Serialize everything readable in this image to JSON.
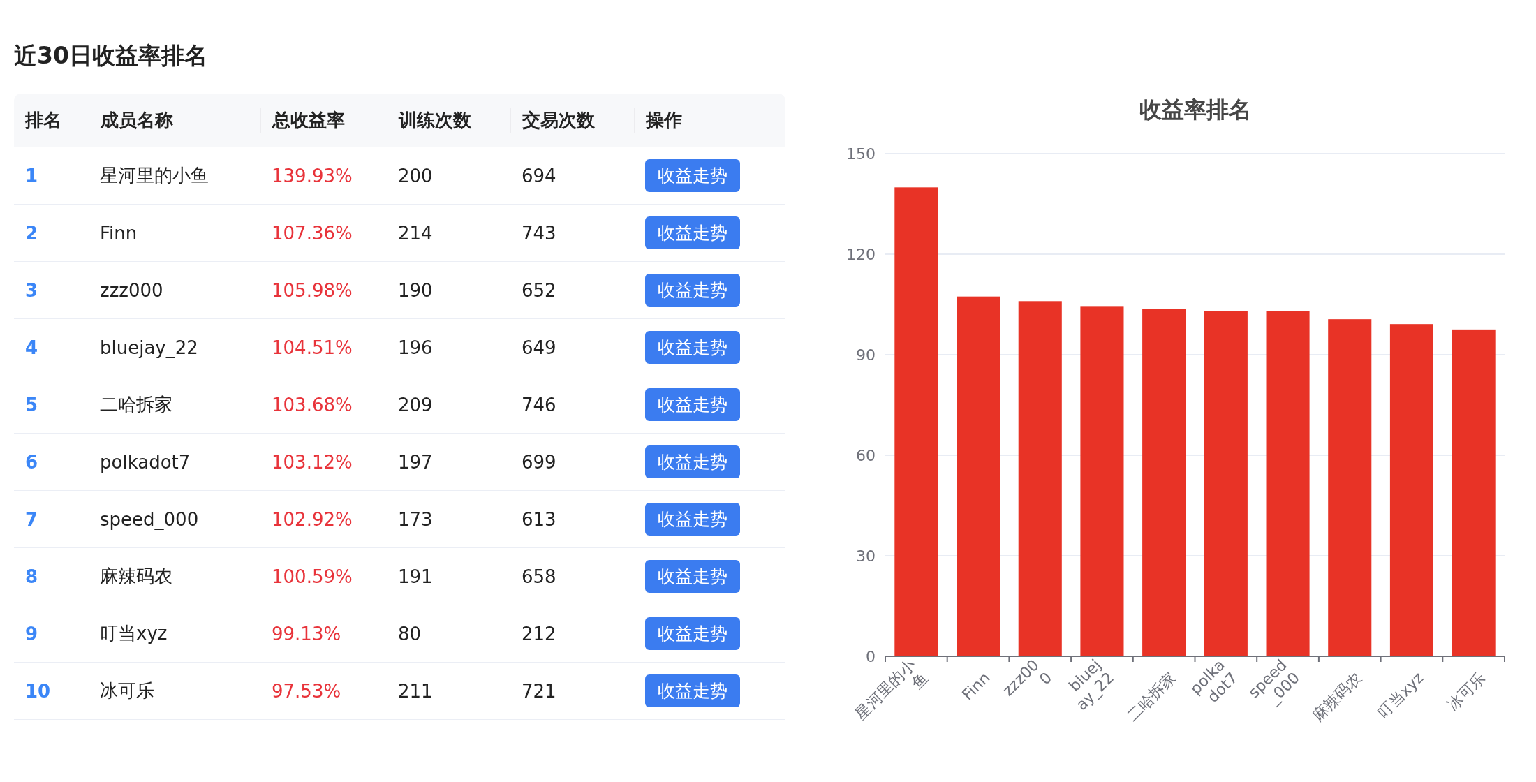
{
  "title": "近30日收益率排名",
  "table": {
    "columns": [
      "排名",
      "成员名称",
      "总收益率",
      "训练次数",
      "交易次数",
      "操作"
    ],
    "rows": [
      {
        "rank": "1",
        "name": "星河里的小鱼",
        "rate": "139.93%",
        "trainings": "200",
        "trades": "694",
        "action": "收益走势"
      },
      {
        "rank": "2",
        "name": "Finn",
        "rate": "107.36%",
        "trainings": "214",
        "trades": "743",
        "action": "收益走势"
      },
      {
        "rank": "3",
        "name": "zzz000",
        "rate": "105.98%",
        "trainings": "190",
        "trades": "652",
        "action": "收益走势"
      },
      {
        "rank": "4",
        "name": "bluejay_22",
        "rate": "104.51%",
        "trainings": "196",
        "trades": "649",
        "action": "收益走势"
      },
      {
        "rank": "5",
        "name": "二哈拆家",
        "rate": "103.68%",
        "trainings": "209",
        "trades": "746",
        "action": "收益走势"
      },
      {
        "rank": "6",
        "name": "polkadot7",
        "rate": "103.12%",
        "trainings": "197",
        "trades": "699",
        "action": "收益走势"
      },
      {
        "rank": "7",
        "name": "speed_000",
        "rate": "102.92%",
        "trainings": "173",
        "trades": "613",
        "action": "收益走势"
      },
      {
        "rank": "8",
        "name": "麻辣码农",
        "rate": "100.59%",
        "trainings": "191",
        "trades": "658",
        "action": "收益走势"
      },
      {
        "rank": "9",
        "name": "叮当xyz",
        "rate": "99.13%",
        "trainings": "80",
        "trades": "212",
        "action": "收益走势"
      },
      {
        "rank": "10",
        "name": "冰可乐",
        "rate": "97.53%",
        "trainings": "211",
        "trades": "721",
        "action": "收益走势"
      }
    ]
  },
  "chart": {
    "chart_data": {
      "type": "bar",
      "title": "收益率排名",
      "categories": [
        "星河里的小鱼",
        "Finn",
        "zzz000",
        "bluejay_22",
        "二哈拆家",
        "polkadot7",
        "speed_000",
        "麻辣码农",
        "叮当xyz",
        "冰可乐"
      ],
      "grid": true,
      "series": [
        {
          "color": "#e83326",
          "values": [
            139.93,
            107.36,
            105.98,
            104.51,
            103.68,
            103.12,
            102.92,
            100.59,
            99.13,
            97.53
          ]
        }
      ],
      "ylim": [
        0,
        150
      ],
      "yticks": [
        0,
        30,
        60,
        90,
        120,
        150
      ]
    }
  }
}
